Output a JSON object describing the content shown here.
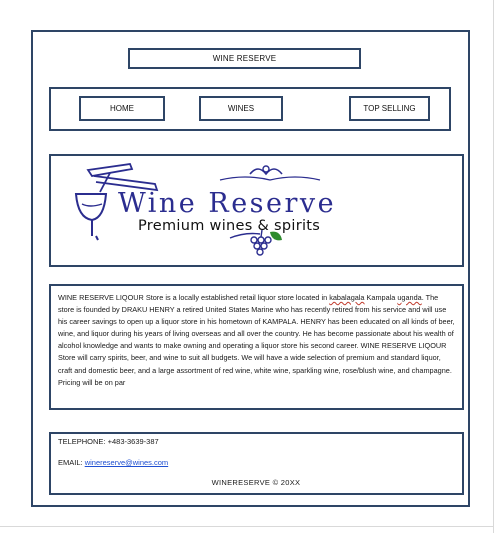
{
  "site": {
    "title": "WINE RESERVE"
  },
  "nav": {
    "items": [
      {
        "label": "HOME"
      },
      {
        "label": "WINES"
      },
      {
        "label": "TOP SELLING"
      }
    ]
  },
  "logo": {
    "title": "Wine Reserve",
    "subtitle": "Premium wines & spirits",
    "colors": {
      "primary": "#2b2d8f",
      "leaf": "#2e8b2e"
    }
  },
  "about": {
    "text_a": "WINE RESERVE LIQOUR Store is a locally established retail liquor store located in ",
    "word_kabalagala": "kabalagala",
    "text_b": " Kampala ",
    "word_uganda": "uganda",
    "text_c": ". The store is founded by DRAKU HENRY a retired United States Marine who has recently retired from his service and will use his career savings to open up a liquor store in his hometown of KAMPALA. HENRY has been educated on all kinds of beer, wine, and liquor during his years of living overseas and all over the country. He has become passionate about his wealth of alcohol knowledge and wants to make owning and operating a liquor store his second career. WINE RESERVE LIQOUR Store will carry spirits, beer, and wine to suit all budgets. We will have a wide selection of premium and standard liquor, craft and domestic beer, and a large assortment of red wine, white wine, sparkling wine, rose/blush wine, and champagne. Pricing will be on par"
  },
  "contact": {
    "telephone": "TELEPHONE: +483-3639-387",
    "email_label": "EMAIL: ",
    "email": "winereserve@wines.com",
    "copyright": "WINERESERVE © 20XX"
  },
  "colors": {
    "border": "#2e4566"
  }
}
